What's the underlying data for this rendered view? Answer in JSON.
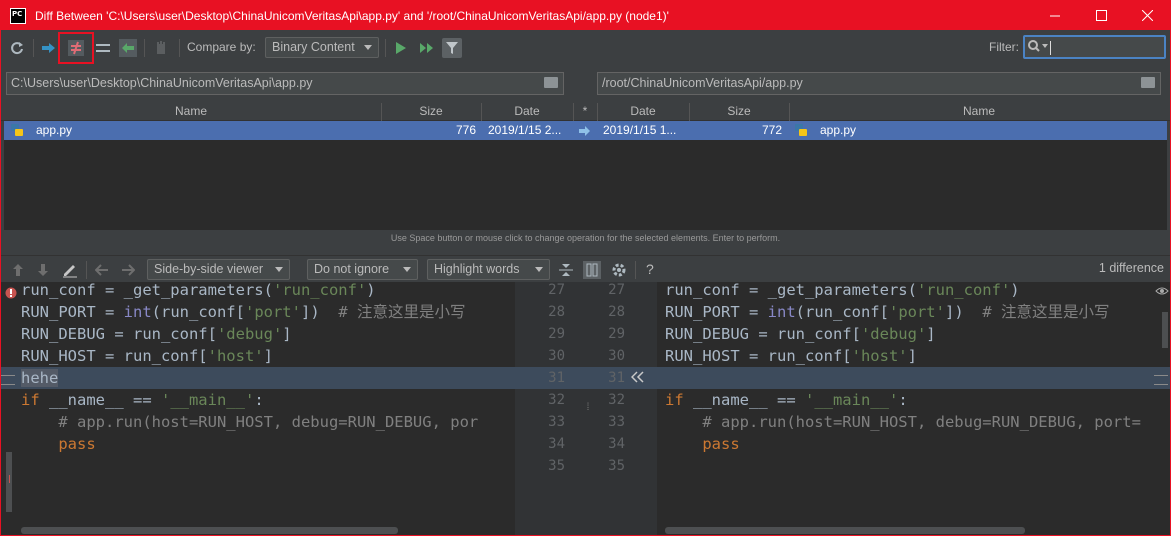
{
  "window": {
    "title": "Diff Between 'C:\\Users\\user\\Desktop\\ChinaUnicomVeritasApi\\app.py' and '/root/ChinaUnicomVeritasApi/app.py (node1)'",
    "logo_text": "PC",
    "accent_color": "#e81123"
  },
  "toolbar": {
    "compare_label": "Compare by:",
    "compare_value": "Binary Content",
    "filter_label": "Filter:",
    "filter_value": ""
  },
  "paths": {
    "left": "C:\\Users\\user\\Desktop\\ChinaUnicomVeritasApi\\app.py",
    "right": "/root/ChinaUnicomVeritasApi/app.py"
  },
  "table": {
    "headers": {
      "name_l": "Name",
      "size_l": "Size",
      "date_l": "Date",
      "star": "*",
      "date_r": "Date",
      "size_r": "Size",
      "name_r": "Name"
    },
    "row": {
      "name_l": "app.py",
      "size_l": "776",
      "date_l": "2019/1/15 2...",
      "date_r": "2019/1/15 1...",
      "size_r": "772",
      "name_r": "app.py"
    },
    "hint": "Use Space button or mouse click to change operation for the selected elements. Enter to perform."
  },
  "diff_toolbar": {
    "viewer": "Side-by-side viewer",
    "ignore": "Do not ignore",
    "highlight": "Highlight words",
    "help": "?",
    "diff_count": "1 difference"
  },
  "editor": {
    "left_lines": [
      [
        [
          "tx",
          "run_conf = _get_parameters("
        ],
        [
          "st",
          "'run_conf'"
        ],
        [
          "tx",
          ")"
        ]
      ],
      [
        [
          "tx",
          "RUN_PORT = "
        ],
        [
          "bi",
          "int"
        ],
        [
          "tx",
          "(run_conf["
        ],
        [
          "st",
          "'port'"
        ],
        [
          "tx",
          "])  "
        ],
        [
          "cm",
          "# 注意这里是小写"
        ]
      ],
      [
        [
          "tx",
          "RUN_DEBUG = run_conf["
        ],
        [
          "st",
          "'debug'"
        ],
        [
          "tx",
          "]"
        ]
      ],
      [
        [
          "tx",
          "RUN_HOST = run_conf["
        ],
        [
          "st",
          "'host'"
        ],
        [
          "tx",
          "]"
        ]
      ],
      [
        [
          "tx",
          "hehe"
        ]
      ],
      [
        [
          "kw",
          "if "
        ],
        [
          "tx",
          "__name__ == "
        ],
        [
          "st",
          "'__main__'"
        ],
        [
          "tx",
          ":"
        ]
      ],
      [
        [
          "cm",
          "    # app.run(host=RUN_HOST, debug=RUN_DEBUG, por"
        ]
      ],
      [
        [
          "kw",
          "    pass"
        ]
      ],
      []
    ],
    "right_lines": [
      [
        [
          "tx",
          "run_conf = _get_parameters("
        ],
        [
          "st",
          "'run_conf'"
        ],
        [
          "tx",
          ")"
        ]
      ],
      [
        [
          "tx",
          "RUN_PORT = "
        ],
        [
          "bi",
          "int"
        ],
        [
          "tx",
          "(run_conf["
        ],
        [
          "st",
          "'port'"
        ],
        [
          "tx",
          "])  "
        ],
        [
          "cm",
          "# 注意这里是小写"
        ]
      ],
      [
        [
          "tx",
          "RUN_DEBUG = run_conf["
        ],
        [
          "st",
          "'debug'"
        ],
        [
          "tx",
          "]"
        ]
      ],
      [
        [
          "tx",
          "RUN_HOST = run_conf["
        ],
        [
          "st",
          "'host'"
        ],
        [
          "tx",
          "]"
        ]
      ],
      [],
      [
        [
          "kw",
          "if "
        ],
        [
          "tx",
          "__name__ == "
        ],
        [
          "st",
          "'__main__'"
        ],
        [
          "tx",
          ":"
        ]
      ],
      [
        [
          "cm",
          "    # app.run(host=RUN_HOST, debug=RUN_DEBUG, port="
        ]
      ],
      [
        [
          "kw",
          "    pass"
        ]
      ],
      []
    ],
    "left_numbers": [
      "27",
      "28",
      "29",
      "30",
      "31",
      "32",
      "33",
      "34",
      "35"
    ],
    "right_numbers": [
      "27",
      "28",
      "29",
      "30",
      "31",
      "32",
      "33",
      "34",
      "35"
    ],
    "changed_index": 4,
    "changed_color": "#3d4b5c"
  }
}
